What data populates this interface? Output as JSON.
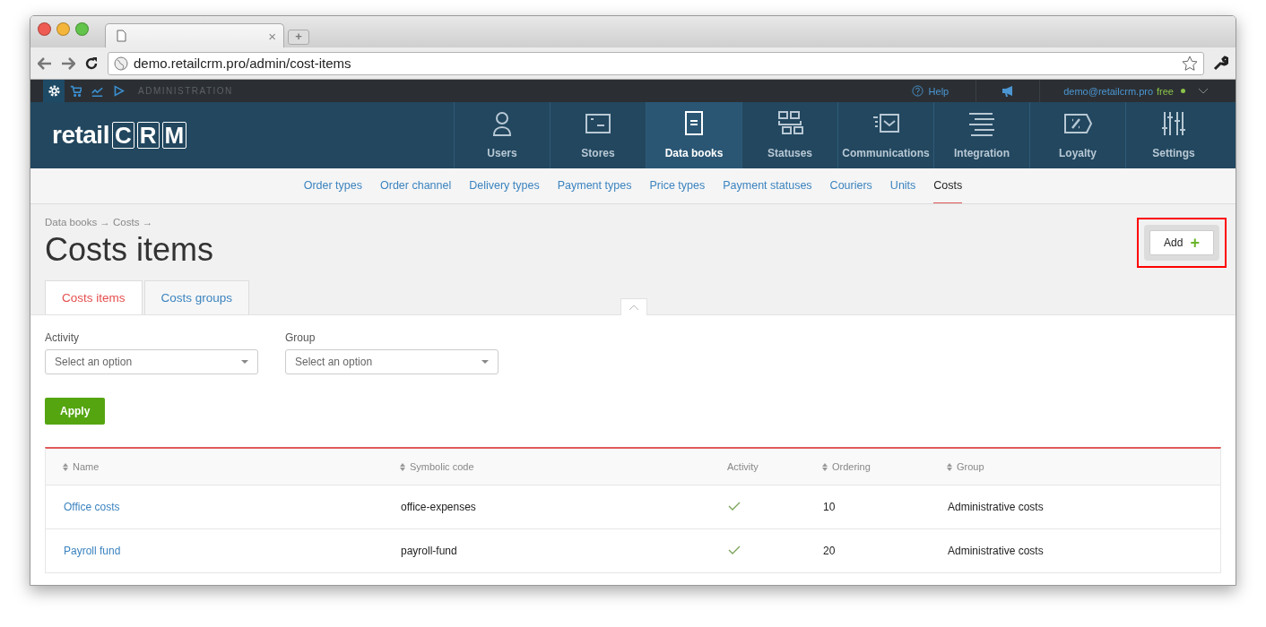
{
  "browser": {
    "tab_close": "×",
    "new_tab": "+",
    "url": "demo.retailcrm.pro/admin/cost-items"
  },
  "admin_bar": {
    "apps": [
      {
        "kind": "settings",
        "selected": true
      },
      {
        "kind": "cart",
        "selected": false
      },
      {
        "kind": "chart",
        "selected": false
      },
      {
        "kind": "play",
        "selected": false
      }
    ],
    "title": "ADMINISTRATION",
    "help": "Help",
    "user": "demo@retailcrm.pro",
    "plan": "free"
  },
  "logo": {
    "word": "retail",
    "letters": [
      "C",
      "R",
      "M"
    ]
  },
  "nav": [
    {
      "label": "Users",
      "kind": "user",
      "selected": false
    },
    {
      "label": "Stores",
      "kind": "store",
      "selected": false
    },
    {
      "label": "Data books",
      "kind": "book",
      "selected": true
    },
    {
      "label": "Statuses",
      "kind": "grid",
      "selected": false
    },
    {
      "label": "Communications",
      "kind": "mail",
      "selected": false
    },
    {
      "label": "Integration",
      "kind": "lines",
      "selected": false
    },
    {
      "label": "Loyalty",
      "kind": "percent",
      "selected": false
    },
    {
      "label": "Settings",
      "kind": "sliders",
      "selected": false
    }
  ],
  "subnav": [
    {
      "label": "Order types",
      "selected": false
    },
    {
      "label": "Order channel",
      "selected": false
    },
    {
      "label": "Delivery types",
      "selected": false
    },
    {
      "label": "Payment types",
      "selected": false
    },
    {
      "label": "Price types",
      "selected": false
    },
    {
      "label": "Payment statuses",
      "selected": false
    },
    {
      "label": "Couriers",
      "selected": false
    },
    {
      "label": "Units",
      "selected": false
    },
    {
      "label": "Costs",
      "selected": true
    }
  ],
  "breadcrumb": "Data books → Costs →",
  "title": "Costs items",
  "add_button": {
    "label": "Add",
    "icon": "+",
    "highlighted": true
  },
  "tabs": [
    {
      "label": "Costs items",
      "selected": true
    },
    {
      "label": "Costs groups",
      "selected": false
    }
  ],
  "filters": [
    {
      "label": "Activity",
      "placeholder": "Select an option"
    },
    {
      "label": "Group",
      "placeholder": "Select an option"
    }
  ],
  "apply": "Apply",
  "table": {
    "columns": [
      {
        "label": "Name",
        "sortable": true
      },
      {
        "label": "Symbolic code",
        "sortable": true
      },
      {
        "label": "Activity",
        "sortable": false
      },
      {
        "label": "Ordering",
        "sortable": true
      },
      {
        "label": "Group",
        "sortable": true
      }
    ],
    "rows": [
      {
        "name": "Office costs",
        "code": "office-expenses",
        "active": true,
        "ordering": "10",
        "group": "Administrative costs"
      },
      {
        "name": "Payroll fund",
        "code": "payroll-fund",
        "active": true,
        "ordering": "20",
        "group": "Administrative costs"
      }
    ]
  }
}
